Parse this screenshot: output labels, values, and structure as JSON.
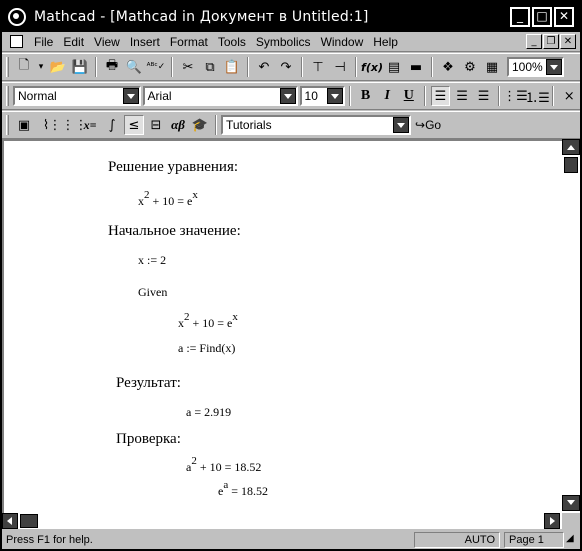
{
  "window": {
    "title": "Mathcad - [Mathcad in Документ в Untitled:1]",
    "minimize": "_",
    "maximize": "□",
    "close": "✕"
  },
  "menu": {
    "items": [
      "File",
      "Edit",
      "View",
      "Insert",
      "Format",
      "Tools",
      "Symbolics",
      "Window",
      "Help"
    ]
  },
  "toolbar1": {
    "zoom": "100%"
  },
  "toolbar2": {
    "style": "Normal",
    "font": "Arial",
    "size": "10",
    "bold": "B",
    "italic": "I",
    "underline": "U"
  },
  "toolbar3": {
    "tutorials": "Tutorials",
    "go": "Go",
    "xeq": "x=",
    "alphabeta": "αβ"
  },
  "document": {
    "h1": "Решение уравнения:",
    "eq1": {
      "base": "x",
      "exp": "2",
      "mid": " + 10 = e",
      "exp2": "x"
    },
    "h2": "Начальное значение:",
    "assign": "x := 2",
    "given": "Given",
    "eq2": {
      "base": "x",
      "exp": "2",
      "mid": " + 10 = e",
      "exp2": "x"
    },
    "find": "a := Find(x)",
    "h3": "Результат:",
    "result": "a = 2.919",
    "h4": "Проверка:",
    "check1": {
      "base": "a",
      "exp": "2",
      "rest": " + 10 = 18.52"
    },
    "check2": {
      "base": "e",
      "exp": "a",
      "rest": " = 18.52"
    }
  },
  "status": {
    "help": "Press F1 for help.",
    "mode": "AUTO",
    "page": "Page 1"
  }
}
